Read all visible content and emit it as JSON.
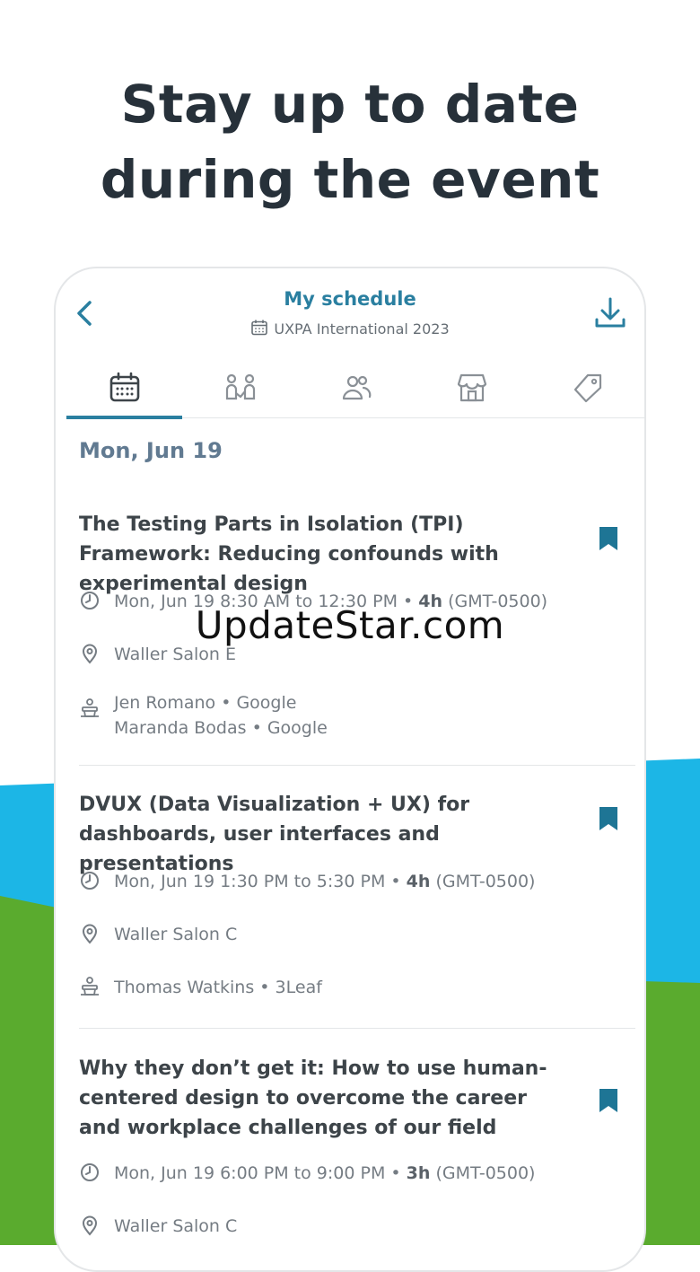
{
  "headline": {
    "line1": "Stay up to date",
    "line2": "during the event"
  },
  "colors": {
    "accent": "#2a7fa0",
    "bg_blue": "#1cb6e6",
    "bg_green": "#5aab2e",
    "headline": "#27313a"
  },
  "header": {
    "title": "My schedule",
    "subtitle": "UXPA International 2023"
  },
  "tabs": [
    {
      "icon": "calendar-icon",
      "active": true
    },
    {
      "icon": "networking-icon",
      "active": false
    },
    {
      "icon": "people-icon",
      "active": false
    },
    {
      "icon": "store-icon",
      "active": false
    },
    {
      "icon": "tag-icon",
      "active": false
    }
  ],
  "schedule": {
    "day": "Mon, Jun 19",
    "sessions": [
      {
        "title": "The Testing Parts in Isolation (TPI) Framework: Reducing confounds with experimental design",
        "time": "Mon, Jun 19 8:30 AM to 12:30 PM •",
        "duration": "4h",
        "tz": "(GMT-0500)",
        "location": "Waller Salon E",
        "speakers": [
          "Jen Romano • Google",
          "Maranda Bodas • Google"
        ]
      },
      {
        "title": "DVUX (Data Visualization + UX) for dashboards, user interfaces and presentations",
        "time": "Mon, Jun 19 1:30 PM to 5:30 PM •",
        "duration": "4h",
        "tz": "(GMT-0500)",
        "location": "Waller Salon C",
        "speakers": [
          "Thomas Watkins • 3Leaf"
        ]
      },
      {
        "title": "Why they don’t get it: How to use human-centered design to overcome the career and workplace challenges of our field",
        "time": "Mon, Jun 19 6:00 PM to 9:00 PM •",
        "duration": "3h",
        "tz": "(GMT-0500)",
        "location": "Waller Salon C"
      }
    ]
  },
  "watermark": "UpdateStar.com"
}
